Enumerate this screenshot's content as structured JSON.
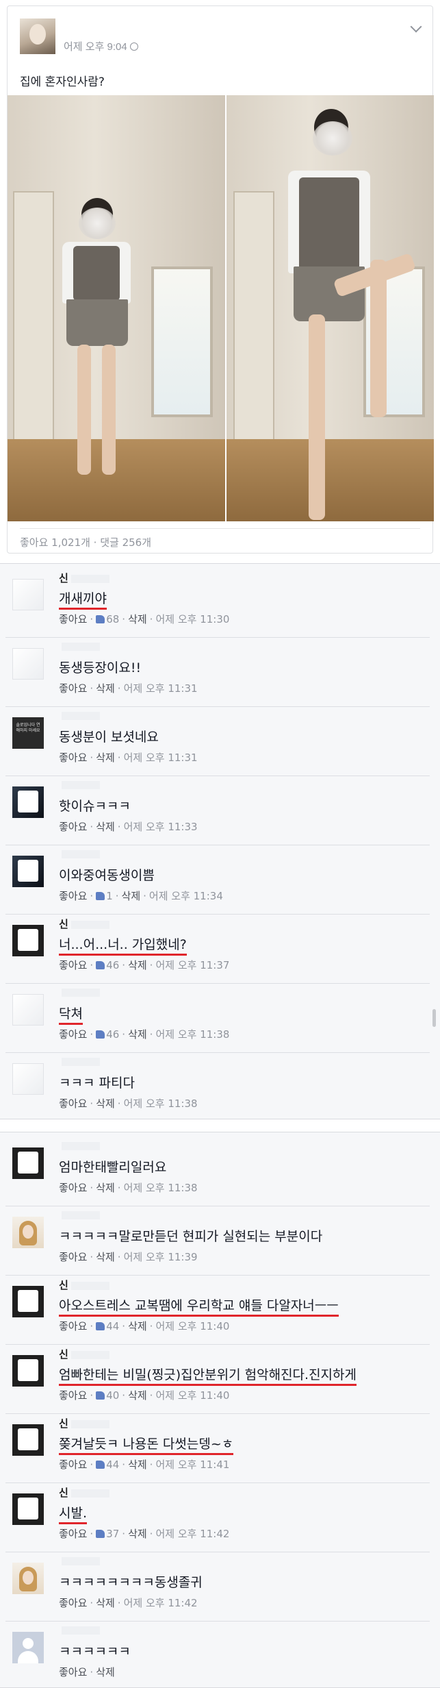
{
  "post": {
    "author": "",
    "time": "어제 오후 9:04",
    "text": "집에 혼자인사람?",
    "stats": "좋아요 1,021개 · 댓글 256개"
  },
  "comment_actions": {
    "like": "좋아요",
    "delete": "삭제"
  },
  "comments_panel_1": [
    {
      "author": "신",
      "text": "개새끼야",
      "likes": "68",
      "time": "어제 오후 11:30",
      "avatar": "light",
      "underlined": true
    },
    {
      "author": "",
      "text": "동생등장이요!!",
      "likes": "",
      "time": "어제 오후 11:31",
      "avatar": "light",
      "underlined": false
    },
    {
      "author": "",
      "text": "동생분이 보셧네요",
      "likes": "",
      "time": "어제 오후 11:31",
      "avatar": "book",
      "underlined": false
    },
    {
      "author": "",
      "text": "핫이슈ㅋㅋㅋ",
      "likes": "",
      "time": "어제 오후 11:33",
      "avatar": "dark2",
      "underlined": false
    },
    {
      "author": "",
      "text": "이와중여동생이쁨",
      "likes": "1",
      "time": "어제 오후 11:34",
      "avatar": "dark2",
      "underlined": false
    },
    {
      "author": "신",
      "text": "너...어...너.. 가입했네?",
      "likes": "46",
      "time": "어제 오후 11:37",
      "avatar": "dark",
      "underlined": true
    },
    {
      "author": "",
      "text": "닥쳐",
      "likes": "46",
      "time": "어제 오후 11:38",
      "avatar": "light",
      "underlined": true
    },
    {
      "author": "",
      "text": "ㅋㅋㅋ 파티다",
      "likes": "",
      "time": "어제 오후 11:38",
      "avatar": "light",
      "underlined": false
    }
  ],
  "comments_panel_2": [
    {
      "author": "",
      "text": "엄마한태빨리일러요",
      "likes": "",
      "time": "어제 오후 11:38",
      "avatar": "dark",
      "underlined": false
    },
    {
      "author": "",
      "text": "ㅋㅋㅋㅋㅋ말로만듣던 현피가 실현되는 부분이다",
      "likes": "",
      "time": "어제 오후 11:39",
      "avatar": "blond",
      "underlined": false
    },
    {
      "author": "신",
      "text": "아오스트레스 교복땜에 우리학교 얘들 다알자너ㅡㅡ",
      "likes": "44",
      "time": "어제 오후 11:40",
      "avatar": "dark",
      "underlined": true
    },
    {
      "author": "신",
      "text": "엄빠한테는 비밀(찡긋)집안분위기 험악해진다.진지하게",
      "likes": "40",
      "time": "어제 오후 11:40",
      "avatar": "dark",
      "underlined": true
    },
    {
      "author": "신",
      "text": "쫒겨날듯ㅋ 나용돈 다썻는뎅~ㅎ",
      "likes": "44",
      "time": "어제 오후 11:41",
      "avatar": "dark",
      "underlined": true
    },
    {
      "author": "신",
      "text": "시발.",
      "likes": "37",
      "time": "어제 오후 11:42",
      "avatar": "dark",
      "underlined": true
    },
    {
      "author": "",
      "text": "ㅋㅋㅋㅋㅋㅋㅋㅋ동생졸귀",
      "likes": "",
      "time": "어제 오후 11:42",
      "avatar": "blond",
      "underlined": false
    },
    {
      "author": "",
      "text": "ㅋㅋㅋㅋㅋㅋ",
      "likes": "",
      "time": "",
      "avatar": "default",
      "underlined": false
    }
  ],
  "avatar_book_text": "솔로입니다 연애하지 마세요",
  "colors": {
    "link_blue": "#365899",
    "meta_gray": "#90949c",
    "underline_red": "#e0252b",
    "panel_bg": "#f6f7f9"
  }
}
